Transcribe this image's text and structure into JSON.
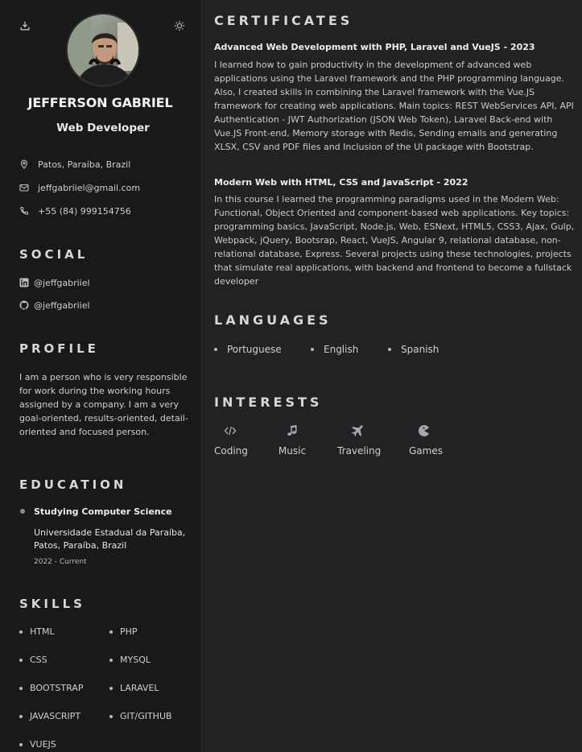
{
  "header": {
    "name": "JEFFERSON GABRIEL",
    "profession": "Web Developer",
    "download_icon": "download-icon",
    "theme_icon": "sun-icon"
  },
  "contact": [
    {
      "icon": "map-pin-icon",
      "text": "Patos, Paraíba, Brazil"
    },
    {
      "icon": "mail-icon",
      "text": "jeffgabriiel@gmail.com"
    },
    {
      "icon": "phone-icon",
      "text": "+55 (84) 999154756"
    }
  ],
  "social": {
    "title": "SOCIAL",
    "items": [
      {
        "icon": "linkedin-icon",
        "text": "@jeffgabriiel"
      },
      {
        "icon": "github-icon",
        "text": "@jeffgabriiel"
      }
    ]
  },
  "profile": {
    "title": "PROFILE",
    "text": "I am a person who is very responsible for work during the working hours assigned by a company. I am a very goal-oriented, results-oriented, detail-oriented and focused person."
  },
  "education": {
    "title": "EDUCATION",
    "items": [
      {
        "degree": "Studying Computer Science",
        "school": "Universidade Estadual da Paraíba, Patos, Paraíba, Brazil",
        "period": "2022 - Current"
      }
    ]
  },
  "skills": {
    "title": "SKILLS",
    "items": [
      "HTML",
      "PHP",
      "CSS",
      "MYSQL",
      "BOOTSTRAP",
      "LARAVEL",
      "JAVASCRIPT",
      "GIT/GITHUB",
      "VUEJS"
    ]
  },
  "certificates": {
    "title": "CERTIFICATES",
    "items": [
      {
        "title": "Advanced Web Development with PHP, Laravel and VueJS - 2023",
        "description": "I learned how to gain productivity in the development of advanced web applications using the Laravel framework and the PHP programming language. Also, I created skills in combining the Laravel framework with the Vue.JS framework for creating web applications. Main topics: REST WebServices API, API Authentication - JWT Authorization (JSON Web Token), Laravel Back-end with Vue.JS Front-end, Memory storage with Redis, Sending emails and generating XLSX, CSV and PDF files and Inclusion of the UI package with Bootstrap."
      },
      {
        "title": "Modern Web with HTML, CSS and JavaScript - 2022",
        "description": "In this course I learned the programming paradigms used in the Modern Web: Functional, Object Oriented and component-based web applications. Key topics: programming basics, JavaScript, Node.js, Web, ESNext, HTML5, CSS3, Ajax, Gulp, Webpack, jQuery, Bootsrap, React, VueJS, Angular 9, relational database, non-relational database, Express. Several projects using these technologies, projects that simulate real applications, with backend and frontend to become a fullstack developer"
      }
    ]
  },
  "languages": {
    "title": "LANGUAGES",
    "items": [
      "Portuguese",
      "English",
      "Spanish"
    ]
  },
  "interests": {
    "title": "INTERESTS",
    "items": [
      {
        "icon": "code-icon",
        "label": "Coding"
      },
      {
        "icon": "music-icon",
        "label": "Music"
      },
      {
        "icon": "airplane-icon",
        "label": "Traveling"
      },
      {
        "icon": "pacman-icon",
        "label": "Games"
      }
    ]
  }
}
